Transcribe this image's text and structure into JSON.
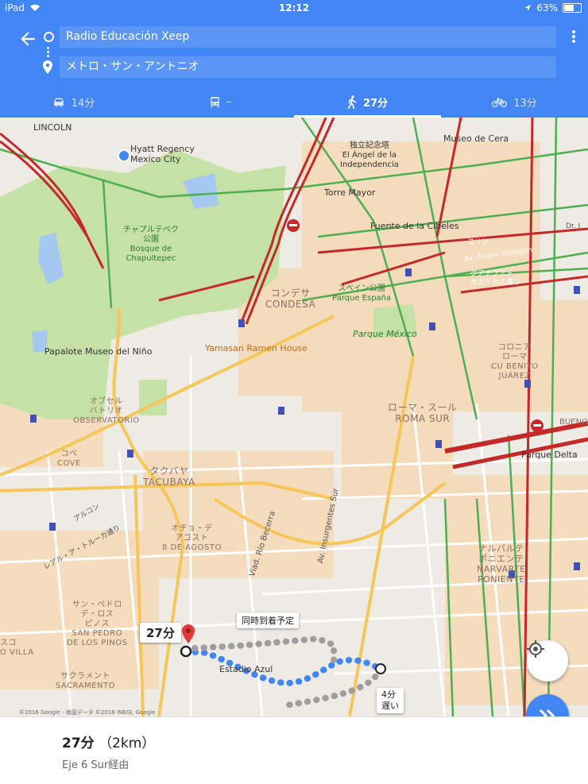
{
  "status_bar": {
    "device": "iPad",
    "time": "12:12",
    "battery": "63%",
    "battery_level": 0.63
  },
  "header": {
    "origin": "Radio Educación Xeep",
    "destination": "メトロ・サン・アントニオ",
    "tabs": [
      {
        "mode": "car-icon",
        "label": "14分"
      },
      {
        "mode": "transit-icon",
        "label": "–"
      },
      {
        "mode": "walk-icon",
        "label": "27分"
      },
      {
        "mode": "bike-icon",
        "label": "13分"
      }
    ],
    "active_tab": 2
  },
  "map": {
    "labels": {
      "lincoln": "LINCOLN",
      "hyatt": "Hyatt Regency\nMexico City",
      "museo_cera": "Museo de Cera",
      "independencia": "独立記念塔\nEl Ángel de la\nIndependencia",
      "torre_mayor": "Torre Mayor",
      "fuente": "Fuente de la Cibeles",
      "chapultepec": "チャプルテペク\n公園\nBosque de\nChapultepec",
      "colima": "コリマ",
      "alvaro": "Av. Álvaro Obregón",
      "guadalajara": "グアナフアト\nサカテカス通り",
      "condesa": "コンデサ\nCONDESA",
      "espana": "スペイン公園\nParque España",
      "parque_mexico": "Parque México",
      "papalote": "Papalote Museo del Niño",
      "yamasan": "Yamasan Ramen House",
      "roma_norte": "コロニア\nローマ\nCU BENITO\nJUÁREZ",
      "observatorio": "オブセル\nバトリオ\nOBSERVATORIO",
      "roma_sur": "ローマ・スール\nROMA SUR",
      "cove": "コベ\nCOVE",
      "parque_delta": "Parque Delta",
      "tacubaya": "タクバヤ\nTACUBAYA",
      "ocho_agosto": "オチョ・デ\nアゴスト\n8 DE AGOSTO",
      "narvarte": "ナルバルテ\nポニエンテ\nNARVARTE\nPONIENTE",
      "san_pedro": "サン・ペドロ\nデ・ロス\nピノス\nSAN PEDRO\nDE LOS PINOS",
      "sacramento": "サクラメント\nSACRAMENTO",
      "villa": "スコ\nO VILLA",
      "estadio": "Estadio Azul",
      "insurgentes": "Av. Insurgentes Sur",
      "becerra": "Viad. Río Becerra",
      "buen": "BUENO",
      "mex_toluca": "レアル・ア・トルーカ通り",
      "alondra": "アルコン",
      "dr": "Dr. J"
    },
    "callouts": {
      "route_time": "27分",
      "same_time": "同時到着予定",
      "alt_time": "4分",
      "alt_delay": "遅い"
    },
    "attribution": "©2016 Google - 地図データ ©2016 INEGI, Google"
  },
  "summary": {
    "time": "27分",
    "distance": "（2km）",
    "via": "Eje 6 Sur経由"
  },
  "colors": {
    "accent": "#4285f4",
    "route": "#4285f4",
    "alt_route": "#9e9e9e",
    "traffic_heavy": "#c62828",
    "traffic_free": "#4caf50",
    "park": "#c5e1a5"
  }
}
